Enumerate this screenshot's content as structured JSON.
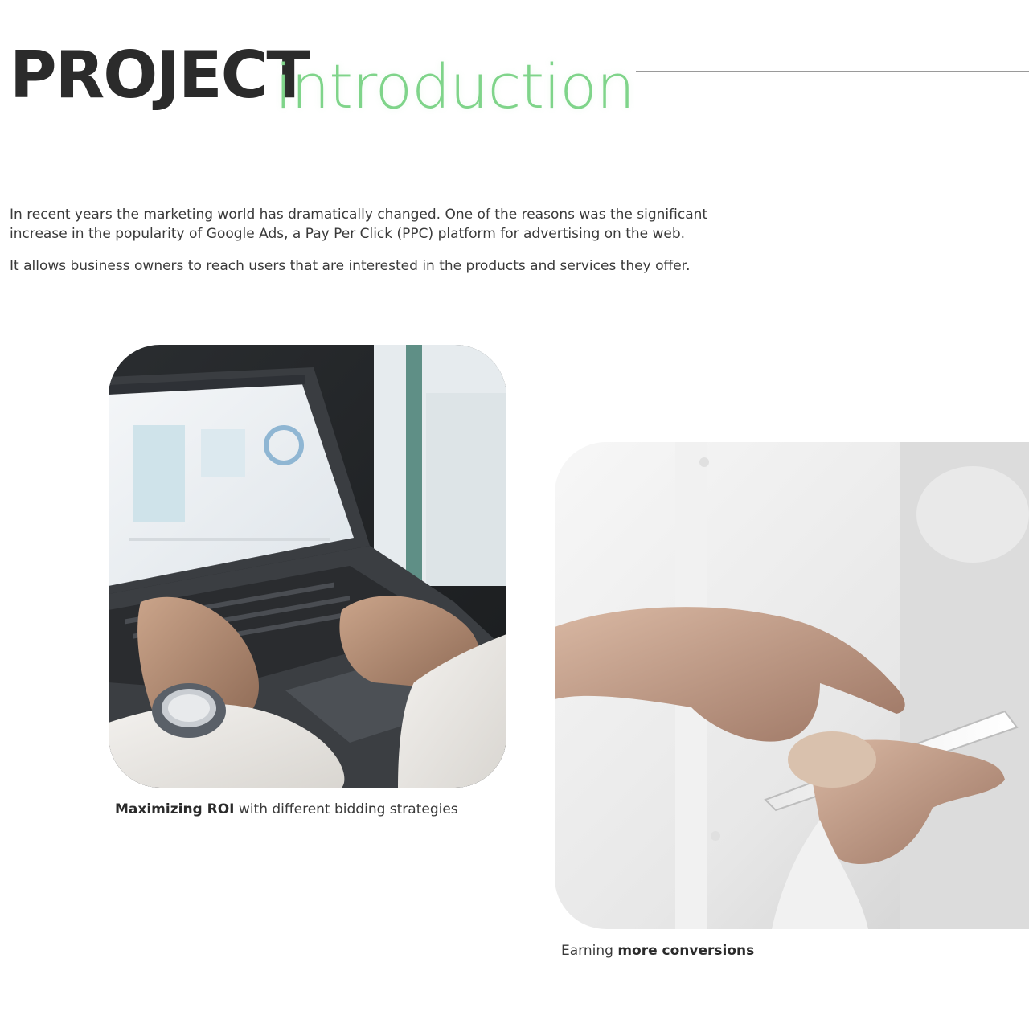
{
  "header": {
    "title_bold": "PROJECT",
    "title_light": "introduction"
  },
  "intro": {
    "paragraph_1": "In recent years the marketing world has dramatically changed. One of the reasons was the significant increase in the popularity of Google Ads, a  Pay Per Click (PPC) platform for advertising on the web.",
    "paragraph_2": "It allows business owners to reach users that are interested in the products and services they offer."
  },
  "cards": [
    {
      "image": "laptop-analytics-photo",
      "caption_bold": "Maximizing ROI",
      "caption_rest": " with different bidding strategies"
    },
    {
      "image": "smartphone-hand-photo",
      "caption_lead": "Earning ",
      "caption_bold": "more conversions"
    }
  ],
  "colors": {
    "accent": "#7fd48a",
    "text_dark": "#2b2b2b",
    "text_body": "#3a3a3a",
    "rule": "#9a9a9a"
  }
}
